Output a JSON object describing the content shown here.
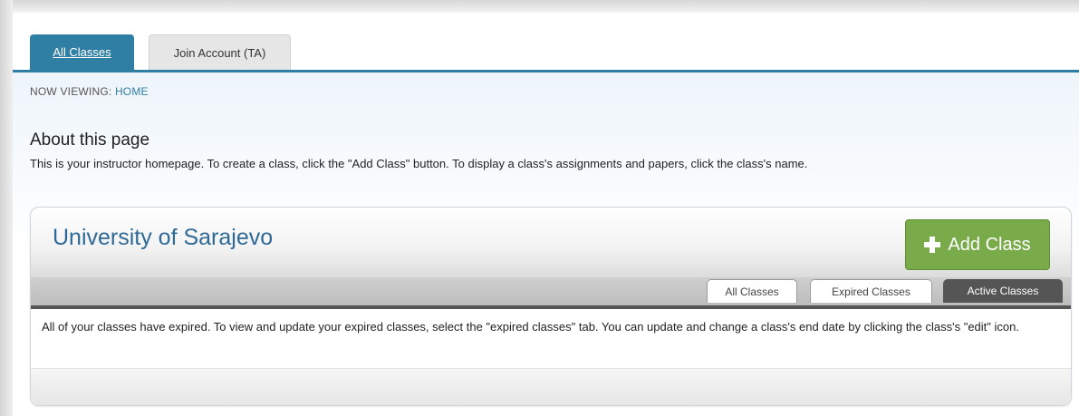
{
  "tabs": {
    "all_classes": "All Classes",
    "join_account": "Join Account (TA)"
  },
  "breadcrumb": {
    "prefix": "NOW VIEWING: ",
    "current": "HOME"
  },
  "about": {
    "title": "About this page",
    "text": "This is your instructor homepage. To create a class, click the \"Add Class\" button. To display a class's assignments and papers, click the class's name."
  },
  "panel": {
    "title": "University of Sarajevo",
    "add_button": "Add Class",
    "subtabs": [
      "All Classes",
      "Expired Classes",
      "Active Classes"
    ],
    "active_subtab": "Active Classes",
    "message": "All of your classes have expired. To view and update your expired classes, select the \"expired classes\" tab. You can update and change a class's end date by clicking the class's \"edit\" icon."
  },
  "colors": {
    "accent": "#2f7ea4",
    "add_button": "#7aab4a",
    "active_subtab": "#555555"
  },
  "icons": {
    "add": "plus-icon"
  }
}
